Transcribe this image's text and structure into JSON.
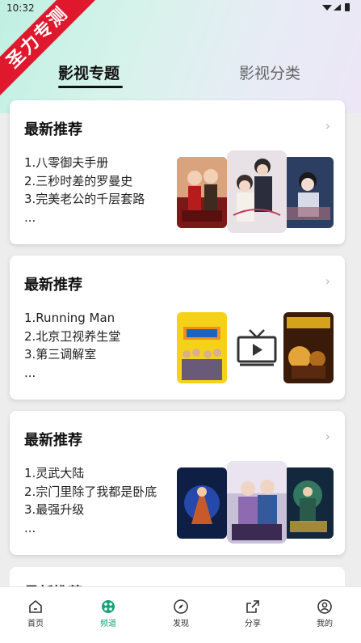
{
  "status": {
    "time": "10:32",
    "icons": "▾◢▮"
  },
  "ribbon": {
    "text": "圣力专测"
  },
  "tabs": {
    "active": "影视专题",
    "inactive": "影视分类"
  },
  "cards": [
    {
      "title": "最新推荐",
      "items": [
        "1.八零御夫手册",
        "2.三秒时差的罗曼史",
        "3.完美老公的千层套路",
        "..."
      ]
    },
    {
      "title": "最新推荐",
      "items": [
        "1.Running Man",
        "2.北京卫视养生堂",
        "3.第三调解室",
        "..."
      ]
    },
    {
      "title": "最新推荐",
      "items": [
        "1.灵武大陆",
        "2.宗门里除了我都是卧底",
        "3.最强升级",
        "..."
      ]
    },
    {
      "title": "最新推荐"
    }
  ],
  "nav": [
    {
      "label": "首页",
      "icon": "home-icon"
    },
    {
      "label": "频道",
      "icon": "channel-icon"
    },
    {
      "label": "发现",
      "icon": "compass-icon"
    },
    {
      "label": "分享",
      "icon": "share-icon"
    },
    {
      "label": "我的",
      "icon": "user-icon"
    }
  ],
  "colors": {
    "accent": "#1aa37a",
    "ribbon": "#e0182e"
  }
}
